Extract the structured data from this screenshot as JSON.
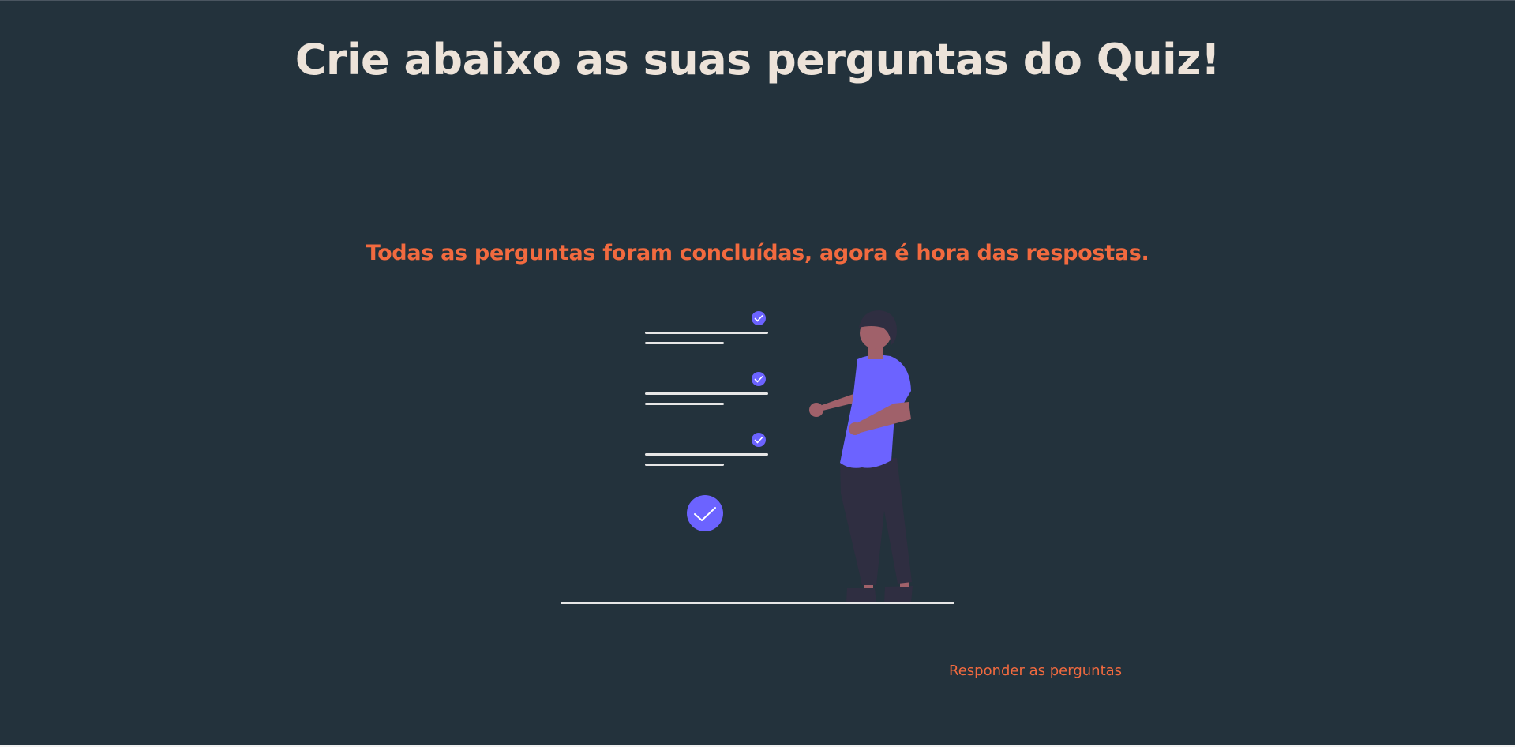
{
  "page": {
    "title": "Crie abaixo as suas perguntas do Quiz!",
    "status_message": "Todas as perguntas foram concluídas, agora é hora das respostas.",
    "answer_link_label": "Responder as perguntas"
  },
  "illustration": {
    "icons": [
      "checklist-icon",
      "check-circle-icon",
      "person-figure"
    ]
  },
  "colors": {
    "background": "#23323c",
    "title_text": "#ede3d9",
    "accent": "#f26a3f",
    "illustration_purple": "#6c63ff",
    "illustration_lines": "#e6e6e6"
  }
}
